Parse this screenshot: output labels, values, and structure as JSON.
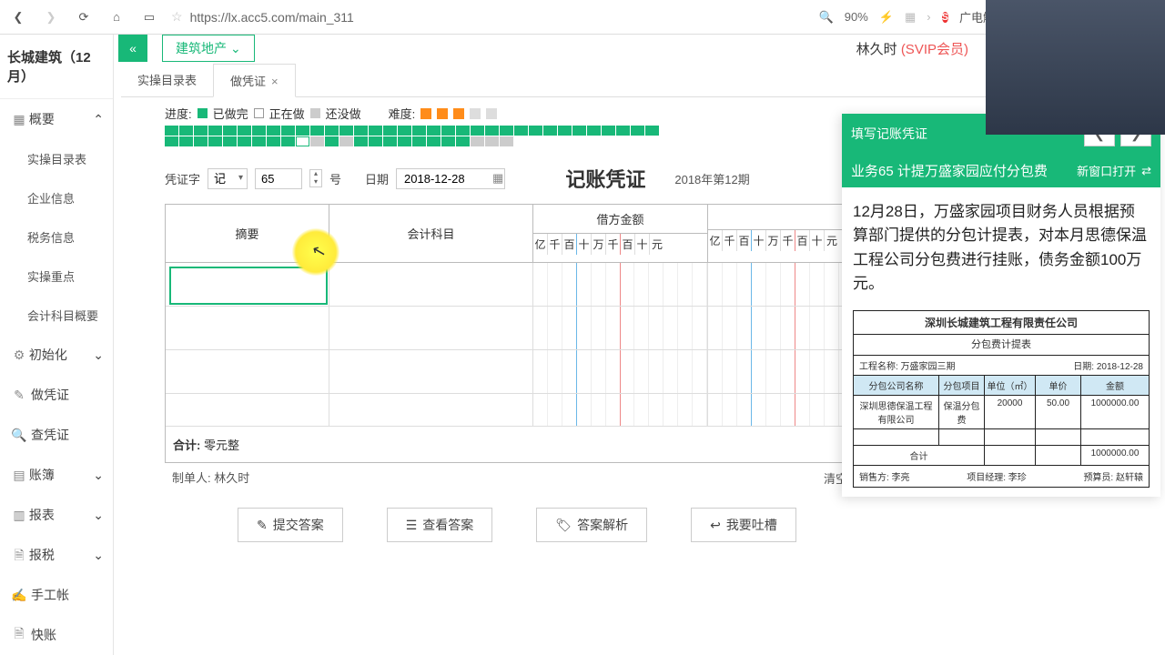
{
  "browser": {
    "url": "https://lx.acc5.com/main_311",
    "zoom": "90%",
    "tab_title": "广电解读鬼畜视频"
  },
  "header": {
    "category": "建筑地产",
    "user_name": "林久时",
    "vip": "(SVIP会员)"
  },
  "sidebar": {
    "company": "长城建筑（12月）",
    "items": [
      {
        "label": "概要",
        "icon": "grid",
        "expand": true
      },
      {
        "label": "初始化",
        "icon": "gear",
        "expand": true
      },
      {
        "label": "做凭证",
        "icon": "pencil",
        "expand": false
      },
      {
        "label": "查凭证",
        "icon": "search",
        "expand": false
      },
      {
        "label": "账簿",
        "icon": "book",
        "expand": true
      },
      {
        "label": "报表",
        "icon": "report",
        "expand": true
      },
      {
        "label": "报税",
        "icon": "doc",
        "expand": true
      },
      {
        "label": "手工帐",
        "icon": "hand",
        "expand": false
      },
      {
        "label": "快账",
        "icon": "doc",
        "expand": false
      }
    ],
    "sub_overview": [
      "实操目录表",
      "企业信息",
      "税务信息",
      "实操重点",
      "会计科目概要"
    ]
  },
  "tabs": [
    {
      "label": "实操目录表",
      "active": false,
      "closable": false
    },
    {
      "label": "做凭证",
      "active": true,
      "closable": true
    }
  ],
  "progress": {
    "label": "进度:",
    "done": "已做完",
    "doing": "正在做",
    "not": "还没做",
    "diff_label": "难度:"
  },
  "voucher": {
    "word_label": "凭证字",
    "word_value": "记",
    "number": "65",
    "number_suffix": "号",
    "date_label": "日期",
    "date_value": "2018-12-28",
    "title": "记账凭证",
    "period": "2018年第12期",
    "columns": {
      "summary": "摘要",
      "account": "会计科目",
      "debit": "借方金额"
    },
    "digits": [
      "亿",
      "千",
      "百",
      "十",
      "万",
      "千",
      "百",
      "十",
      "元"
    ],
    "total_label": "合计:",
    "total_value": "零元整",
    "maker_label": "制单人:",
    "maker_value": "林久时",
    "clear": "清空凭证"
  },
  "actions": {
    "submit": "提交答案",
    "view": "查看答案",
    "analysis": "答案解析",
    "feedback": "我要吐槽"
  },
  "task": {
    "fill_label": "填写记账凭证",
    "title": "业务65 计提万盛家园应付分包费",
    "open_new": "新窗口打开",
    "body": "12月28日，万盛家园项目财务人员根据预算部门提供的分包计提表，对本月思德保温工程公司分包费进行挂账，债务金额100万元。",
    "doc": {
      "caption": "深圳长城建筑工程有限责任公司",
      "sub": "分包费计提表",
      "meta_left": "工程名称: 万盛家园三期",
      "meta_right": "日期: 2018-12-28",
      "headers": [
        "分包公司名称",
        "分包项目",
        "单位（㎡）",
        "单价",
        "金额"
      ],
      "row": [
        "深圳思德保温工程有限公司",
        "保温分包费",
        "20000",
        "50.00",
        "1000000.00"
      ],
      "sum_label": "合计",
      "sum_value": "1000000.00",
      "foot_left": "销售方: 李亮",
      "foot_mid": "项目经理: 李珍",
      "foot_right": "预算员: 赵轩辕"
    }
  }
}
